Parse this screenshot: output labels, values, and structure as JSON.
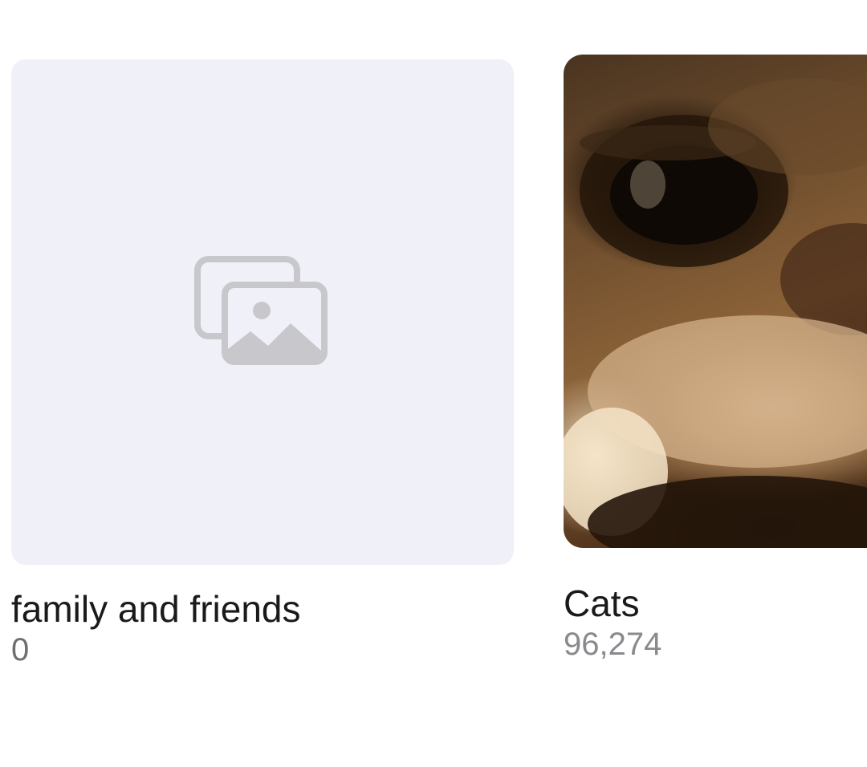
{
  "albums": [
    {
      "title": "family and friends",
      "count": "0",
      "cover": "placeholder"
    },
    {
      "title": "Cats",
      "count": "96,274",
      "cover": "cat-photo"
    }
  ],
  "colors": {
    "placeholder_bg": "#f0f0f9",
    "placeholder_icon": "#c7c7cc",
    "title_text": "#1a1a1a",
    "count_text": "#8a8a8e"
  },
  "icons": {
    "placeholder": "photo-stack-icon"
  }
}
